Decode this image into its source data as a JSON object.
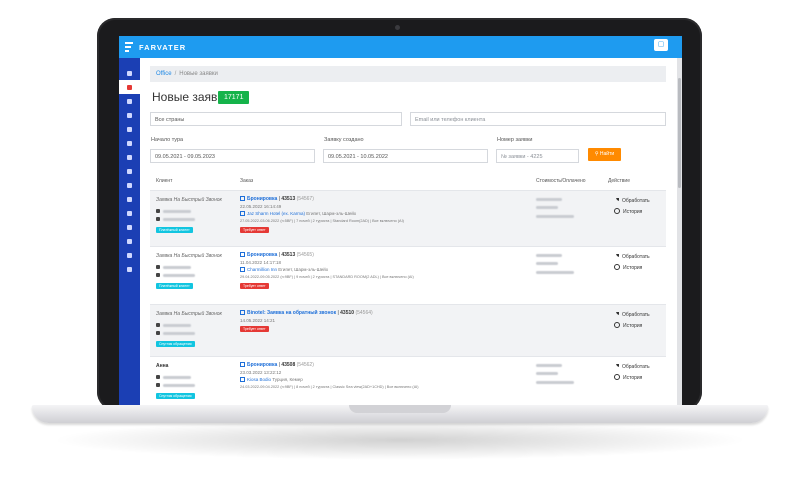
{
  "app": {
    "brand": "FARVATER",
    "topbar_button_icon": "user-icon"
  },
  "colors": {
    "topbar": "#1e9bf0",
    "sidebar": "#1b3fb4",
    "success": "#15b34a",
    "accent": "#ff8a00",
    "danger": "#e53935",
    "info": "#12c5e0"
  },
  "sidebar": {
    "items": [
      {
        "icon": "home-icon"
      },
      {
        "icon": "briefcase-icon",
        "active": true
      },
      {
        "icon": "document-icon"
      },
      {
        "icon": "refresh-icon"
      },
      {
        "icon": "bus-icon"
      },
      {
        "icon": "clipboard-icon"
      },
      {
        "icon": "calendar-icon"
      },
      {
        "icon": "info-icon"
      },
      {
        "icon": "mail-icon"
      },
      {
        "icon": "card-icon"
      },
      {
        "icon": "hotel-icon"
      },
      {
        "icon": "settings-icon"
      },
      {
        "icon": "help-icon"
      },
      {
        "icon": "chart-icon"
      },
      {
        "icon": "power-icon"
      }
    ]
  },
  "breadcrumb": {
    "home": "Office",
    "separator": "/",
    "current": "Новые заявки"
  },
  "page": {
    "title": "Новые заявки",
    "count": "17171"
  },
  "filters": {
    "country": "Все страны",
    "contact_placeholder": "Email или телефон клиента",
    "tour_start_label": "Начало тура",
    "tour_start_value": "09.05.2021 - 09.05.2023",
    "created_label": "Заявку создано",
    "created_value": "09.05.2021 - 10.05.2022",
    "number_label": "Номер заявки",
    "number_value": "№ заявки - 4225",
    "search_button": "Найти"
  },
  "table": {
    "headers": {
      "client": "Клиент",
      "order": "Заказ",
      "cost": "Стоимость/Оплачено",
      "actions": "Действие"
    },
    "rows": [
      {
        "client": "Заявка На Быстрый Звонок",
        "badge": "Платёжный клиент",
        "order_type": "Бронировка",
        "order_num": "43513",
        "order_ref": "(54567)",
        "date": "22.05.2022 16:14:49",
        "hotel": "Jaz Sharm Hotel (ex. Karma)",
        "hotel_place": "Египет, Шарм-эль-Шейх",
        "details": "27.05.2022-03.06.2022 (n:5BF) | 7 ночей | 2 туриста | Standard Room(2AD) | Все включено (AI)",
        "status": "Требует ответ",
        "action1": "Обработать",
        "action2": "История"
      },
      {
        "client": "Заявка На Быстрый Звонок",
        "badge": "Платёжный клиент",
        "order_type": "Бронировка",
        "order_num": "43513",
        "order_ref": "(54565)",
        "date": "11.04.2022 14:17:18",
        "hotel": "Charmillion Inn",
        "hotel_place": "Египет, Шарм-эль-Шейх",
        "details": "29.04.2022-09.05.2022 (n:9BF) | 9 ночей | 2 туриста | STANDARD ROOM(2 ADL) | Все включено (AI)",
        "status": "Требует ответ",
        "action1": "Обработать",
        "action2": "История"
      },
      {
        "client": "Заявка На Быстрый Звонок",
        "badge": "Спутник обращения",
        "order_type": "Binotel: Заявка на обратный звонок",
        "order_num": "43510",
        "order_ref": "(54564)",
        "date": "14.05.2022 14:21",
        "status": "Требует ответ",
        "action1": "Обработать",
        "action2": "История"
      },
      {
        "client": "Анна",
        "badge": "Спутник обращения",
        "order_type": "Бронировка",
        "order_num": "43508",
        "order_ref": "(54562)",
        "date": "23.03.2022 13:22:12",
        "hotel": "Kiosa Bodio",
        "hotel_place": "Турция, Кемер",
        "details": "24.03.2022-09.04.2022 (n:9BF) | 8 ночей | 2 туриста | Classic Sea view(2AD+1CHD) | Все включено (AI)",
        "action1": "Обработать",
        "action2": "История"
      }
    ]
  }
}
